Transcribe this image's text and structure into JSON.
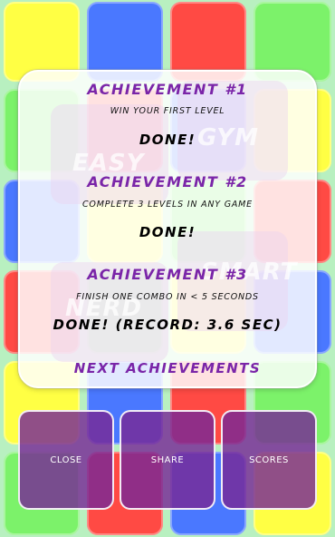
{
  "background_words": {
    "gym": "GYM",
    "easy": "EASY",
    "smart": "SMART",
    "nerd": "NERD"
  },
  "achievements": [
    {
      "title": "ACHIEVEMENT #1",
      "description": "WIN YOUR FIRST LEVEL",
      "status": "DONE!"
    },
    {
      "title": "ACHIEVEMENT #2",
      "description": "COMPLETE 3 LEVELS IN ANY GAME",
      "status": "DONE!"
    },
    {
      "title": "ACHIEVEMENT #3",
      "description": "FINISH ONE COMBO IN < 5 SECONDS",
      "status": "DONE! (RECORD: 3.6 SEC)"
    }
  ],
  "next_label": "NEXT ACHIEVEMENTS",
  "buttons": {
    "close": "CLOSE",
    "share": "SHARE",
    "scores": "SCORES"
  },
  "colors": {
    "accent_purple": "#7a25a8",
    "tile_yellow": "#ffff44",
    "tile_blue": "#4a78ff",
    "tile_red": "#ff4a44",
    "tile_green": "#7cf26a"
  }
}
